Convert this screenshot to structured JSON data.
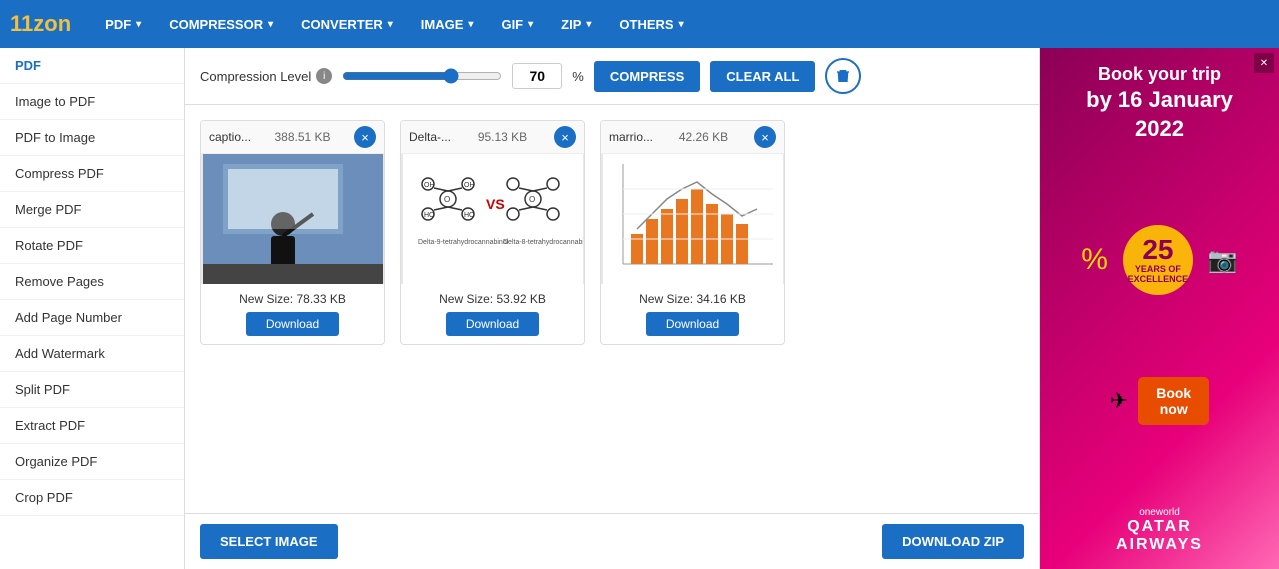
{
  "logo": {
    "text_before": "11z",
    "text_highlight": "o",
    "text_after": "n"
  },
  "nav": {
    "items": [
      {
        "label": "PDF",
        "id": "pdf"
      },
      {
        "label": "COMPRESSOR",
        "id": "compressor"
      },
      {
        "label": "CONVERTER",
        "id": "converter"
      },
      {
        "label": "IMAGE",
        "id": "image"
      },
      {
        "label": "GIF",
        "id": "gif"
      },
      {
        "label": "ZIP",
        "id": "zip"
      },
      {
        "label": "OTHERS",
        "id": "others"
      }
    ]
  },
  "sidebar": {
    "items": [
      {
        "label": "PDF",
        "id": "pdf",
        "active": true
      },
      {
        "label": "Image to PDF",
        "id": "image-to-pdf"
      },
      {
        "label": "PDF to Image",
        "id": "pdf-to-image"
      },
      {
        "label": "Compress PDF",
        "id": "compress-pdf"
      },
      {
        "label": "Merge PDF",
        "id": "merge-pdf"
      },
      {
        "label": "Rotate PDF",
        "id": "rotate-pdf"
      },
      {
        "label": "Remove Pages",
        "id": "remove-pages"
      },
      {
        "label": "Add Page Number",
        "id": "add-page-number"
      },
      {
        "label": "Add Watermark",
        "id": "add-watermark"
      },
      {
        "label": "Split PDF",
        "id": "split-pdf"
      },
      {
        "label": "Extract PDF",
        "id": "extract-pdf"
      },
      {
        "label": "Organize PDF",
        "id": "organize-pdf"
      },
      {
        "label": "Crop PDF",
        "id": "crop-pdf"
      }
    ]
  },
  "toolbar": {
    "compression_label": "Compression Level",
    "slider_value": 70,
    "percent_sign": "%",
    "compress_btn": "COMPRESS",
    "clear_btn": "CLEAR ALL",
    "trash_icon": "🗑"
  },
  "files": [
    {
      "name": "captio...",
      "size": "388.51 KB",
      "new_size": "New Size: 78.33 KB",
      "download_label": "Download",
      "type": "person"
    },
    {
      "name": "Delta-...",
      "size": "95.13 KB",
      "new_size": "New Size: 53.92 KB",
      "download_label": "Download",
      "type": "formula"
    },
    {
      "name": "marrio...",
      "size": "42.26 KB",
      "new_size": "New Size: 34.16 KB",
      "download_label": "Download",
      "type": "chart"
    }
  ],
  "bottom_bar": {
    "select_label": "SELECT IMAGE",
    "download_zip_label": "DOWNLOAD ZIP"
  },
  "ad": {
    "line1": "Book your trip",
    "line2": "by 16 January",
    "line3": "2022",
    "years_num": "25",
    "years_text": "YEARS OF\nEXCELLENCE",
    "book_btn": "Book\nnow",
    "sub_text": "oneworld",
    "brand": "QATAR\nAIRWAYS"
  }
}
